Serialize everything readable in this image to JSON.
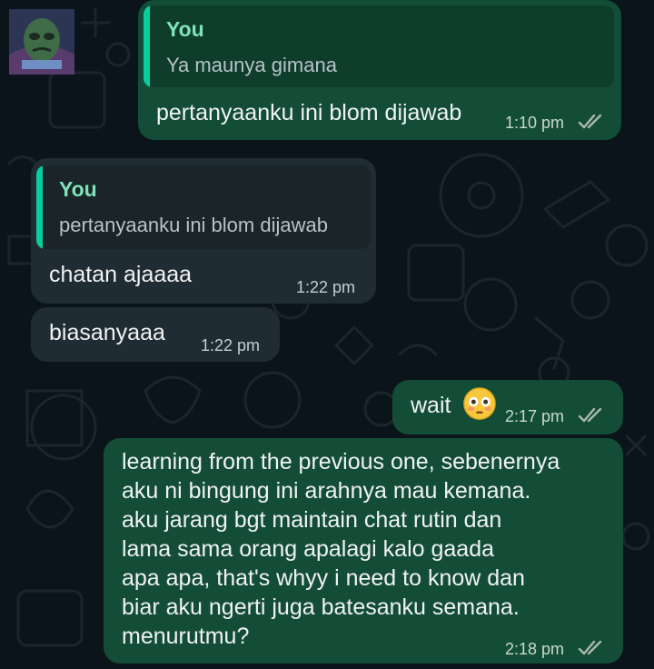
{
  "messages": {
    "m1": {
      "quote_name": "You",
      "quote_text": "Ya maunya gimana",
      "text": "pertanyaanku ini blom dijawab",
      "time": "1:10 pm"
    },
    "m2": {
      "quote_name": "You",
      "quote_text": "pertanyaanku ini blom dijawab",
      "text": "chatan ajaaaa",
      "time": "1:22 pm"
    },
    "m3": {
      "text": "biasanyaaa",
      "time": "1:22 pm"
    },
    "m4": {
      "text": "wait",
      "emoji": "flushed-face-icon",
      "time": "2:17 pm"
    },
    "m5": {
      "lines": [
        "learning from the previous one, sebenernya",
        "aku ni bingung ini arahnya mau kemana.",
        "aku jarang bgt maintain chat rutin dan",
        "lama sama orang apalagi kalo gaada",
        "apa apa, that's whyy i need to know dan",
        "biar aku ngerti juga batesanku semana.",
        "menurutmu?"
      ],
      "time": "2:18 pm"
    }
  },
  "colors": {
    "background": "#0b141a",
    "outgoing_bubble": "#134d37",
    "incoming_bubble": "#202c33",
    "quote_accent": "#06cf9c",
    "read_ticks": "#a9b8b1"
  },
  "icons": [
    "avatar-image",
    "double-check-icon",
    "flushed-face-icon"
  ]
}
